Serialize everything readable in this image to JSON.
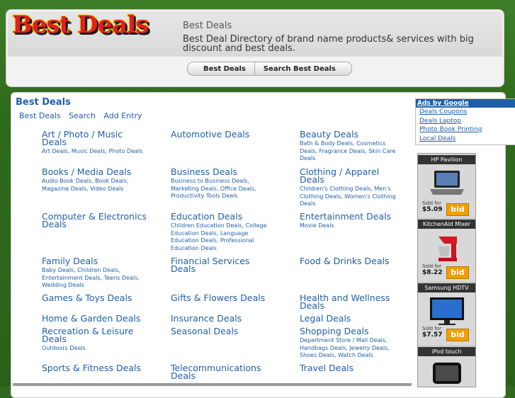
{
  "header": {
    "logo_text": "Best Deals",
    "site_title": "Best Deals",
    "site_description": "Best Deal Directory of brand name products& services with big discount and best deals."
  },
  "nav": {
    "items": [
      "Best Deals",
      "Search Best Deals"
    ]
  },
  "main": {
    "heading": "Best Deals",
    "subnav": [
      "Best Deals",
      "Search",
      "Add Entry"
    ],
    "categories": [
      {
        "title": "Art / Photo / Music Deals",
        "sub": "Art Deals, Music Deals, Photo Deals"
      },
      {
        "title": "Automotive Deals",
        "sub": ""
      },
      {
        "title": "Beauty Deals",
        "sub": "Bath & Body Deals, Cosmetics Deals, Fragrance Deals, Skin Care Deals"
      },
      {
        "title": "Books / Media Deals",
        "sub": "Audio Book Deals, Book Deals, Magazine Deals, Video Deals"
      },
      {
        "title": "Business Deals",
        "sub": "Business to Business Deals, Marketing Deals, Office Deals, Productivity Tools Deals"
      },
      {
        "title": "Clothing / Apparel Deals",
        "sub": "Children's Clothing Deals, Men's Clothing Deals, Women's Clothing Deals"
      },
      {
        "title": "Computer & Electronics Deals",
        "sub": ""
      },
      {
        "title": "Education Deals",
        "sub": "Children Education Deals, College Education Deals, Language Education Deals, Professional Education Deals"
      },
      {
        "title": "Entertainment Deals",
        "sub": "Movie Deals"
      },
      {
        "title": "Family Deals",
        "sub": "Baby Deals, Children Deals, Entertainment Deals, Teens Deals, Wedding Deals"
      },
      {
        "title": "Financial Services Deals",
        "sub": ""
      },
      {
        "title": "Food & Drinks Deals",
        "sub": ""
      },
      {
        "title": "Games & Toys Deals",
        "sub": ""
      },
      {
        "title": "Gifts & Flowers Deals",
        "sub": ""
      },
      {
        "title": "Health and Wellness Deals",
        "sub": ""
      },
      {
        "title": "Home & Garden Deals",
        "sub": ""
      },
      {
        "title": "Insurance Deals",
        "sub": ""
      },
      {
        "title": "Legal Deals",
        "sub": ""
      },
      {
        "title": "Recreation & Leisure Deals",
        "sub": "Outdoors Deals"
      },
      {
        "title": "Seasonal Deals",
        "sub": ""
      },
      {
        "title": "Shopping Deals",
        "sub": "Department Store / Mall Deals, Handbags Deals, Jewelry Deals, Shoes Deals, Watch Deals"
      },
      {
        "title": "Sports & Fitness Deals",
        "sub": ""
      },
      {
        "title": "Telecommunications Deals",
        "sub": ""
      },
      {
        "title": "Travel Deals",
        "sub": ""
      }
    ]
  },
  "ads": {
    "title": "Ads by Google",
    "links": [
      "Deals Coupons",
      "Deals Laptop",
      "Photo Book Printing",
      "Local Deals"
    ]
  },
  "widget": {
    "products": [
      {
        "name": "HP Pavilion",
        "sold_label": "Sold for",
        "price": "$5.09",
        "bid": "bid"
      },
      {
        "name": "KitchenAid Mixer",
        "sold_label": "Sold for",
        "price": "$8.22",
        "bid": "bid"
      },
      {
        "name": "Samsung HDTV",
        "sold_label": "Sold for",
        "price": "$7.57",
        "bid": "bid"
      },
      {
        "name": "iPod touch"
      }
    ]
  },
  "colors": {
    "background": "#2f6a1e",
    "link": "#1f5fa8",
    "ads_header": "#1f5fa8",
    "bid_button": "#f0a000"
  }
}
